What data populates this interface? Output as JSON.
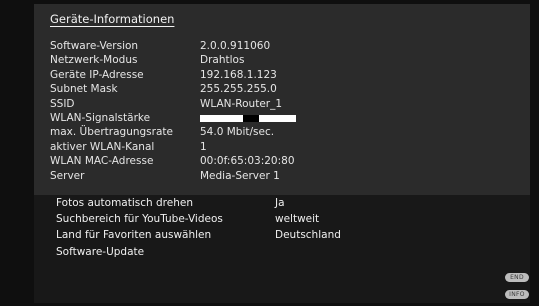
{
  "info": {
    "title": "Geräte-Informationen",
    "rows": [
      {
        "label": "Software-Version",
        "value": "2.0.0.911060"
      },
      {
        "label": "Netzwerk-Modus",
        "value": "Drahtlos"
      },
      {
        "label": "Geräte IP-Adresse",
        "value": "192.168.1.123"
      },
      {
        "label": "Subnet Mask",
        "value": "255.255.255.0"
      },
      {
        "label": "SSID",
        "value": "WLAN-Router_1"
      },
      {
        "label": "WLAN-Signalstärke",
        "value": ""
      },
      {
        "label": "max. Übertragungsrate",
        "value": "54.0 Mbit/sec."
      },
      {
        "label": "aktiver WLAN-Kanal",
        "value": "1"
      },
      {
        "label": "WLAN MAC-Adresse",
        "value": "00:0f:65:03:20:80"
      },
      {
        "label": "Server",
        "value": "Media-Server 1"
      }
    ],
    "signal_strength_fraction": 0.45
  },
  "settings": [
    {
      "label": "Fotos automatisch drehen",
      "value": "Ja"
    },
    {
      "label": "Suchbereich für YouTube-Videos",
      "value": "weltweit"
    },
    {
      "label": "Land für Favoriten auswählen",
      "value": "Deutschland"
    },
    {
      "label": "Software-Update",
      "value": ""
    }
  ],
  "buttons": {
    "end": "END",
    "info": "INFO"
  },
  "colors": {
    "info_panel_bg": "#2b2b2b",
    "settings_panel_bg": "#181818",
    "background": "#0f0f0f"
  }
}
